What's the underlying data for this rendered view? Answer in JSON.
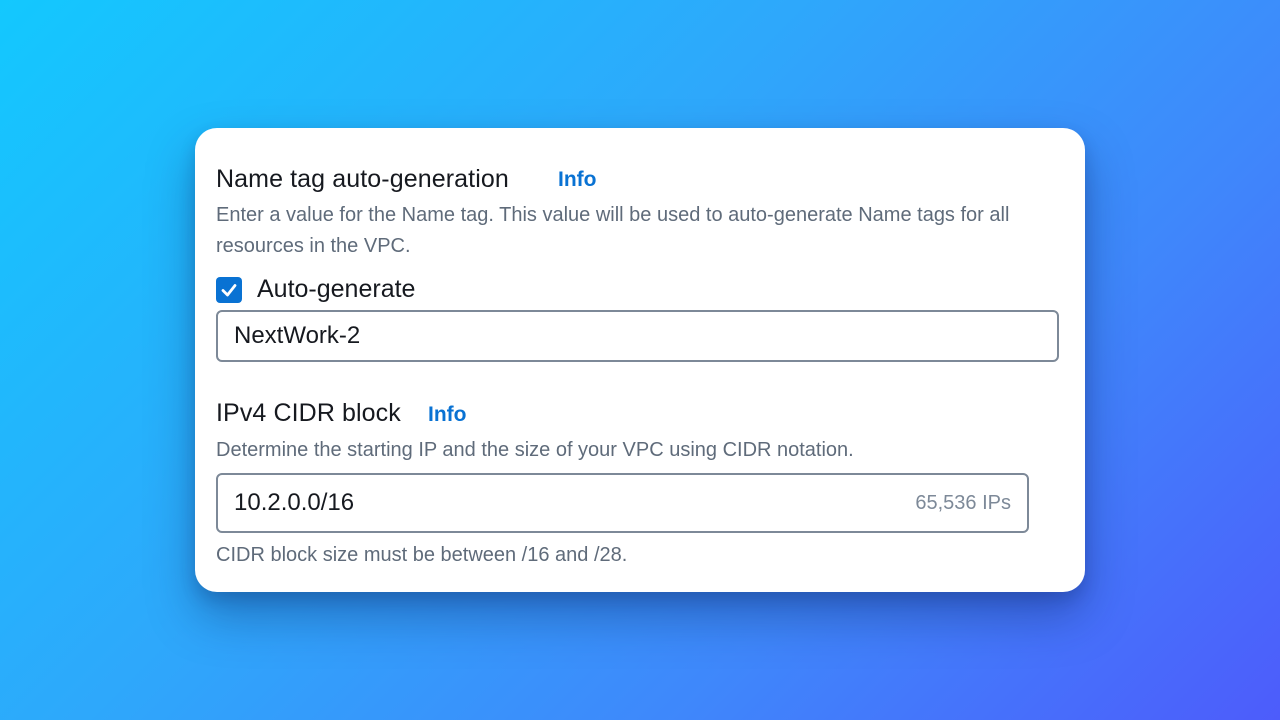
{
  "name_tag": {
    "heading": "Name tag auto-generation",
    "info_label": "Info",
    "description": "Enter a value for the Name tag. This value will be used to auto-generate Name tags for all resources in the VPC.",
    "auto_generate": {
      "checked": true,
      "label": "Auto-generate"
    },
    "input_value": "NextWork-2"
  },
  "cidr": {
    "heading": "IPv4 CIDR block",
    "info_label": "Info",
    "description": "Determine the starting IP and the size of your VPC using CIDR notation.",
    "input_value": "10.2.0.0/16",
    "ip_count": "65,536 IPs",
    "constraint": "CIDR block size must be between /16 and /28."
  },
  "colors": {
    "link": "#0972d3",
    "checkbox": "#0972d3",
    "text_primary": "#16191f",
    "text_secondary": "#5f6b7a",
    "input_border": "#7d8998"
  }
}
